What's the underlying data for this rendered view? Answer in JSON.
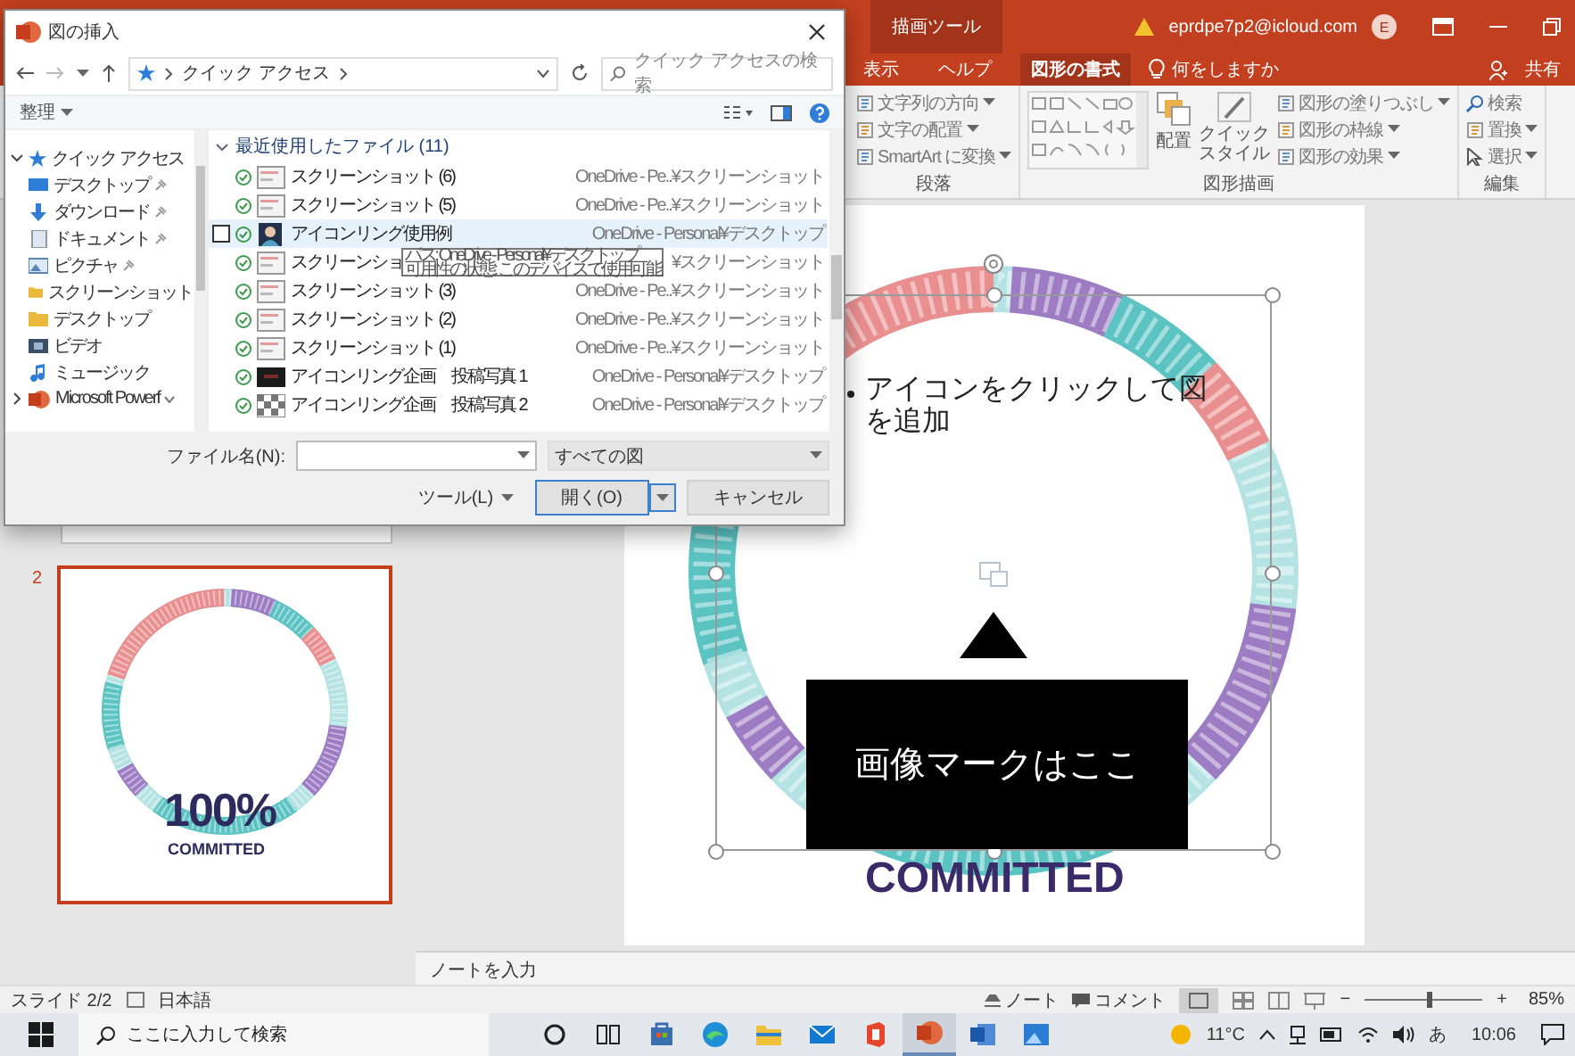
{
  "title_bar": {
    "context_label": "描画ツール",
    "account": "eprdpe7p2@icloud.com",
    "avatar": "E"
  },
  "ribbon_tabs": [
    {
      "label": "表示",
      "selected": false
    },
    {
      "label": "ヘルプ",
      "selected": false
    },
    {
      "label": "図形の書式",
      "selected": true
    }
  ],
  "tell_me": "何をしますか",
  "share": "共有",
  "ribbon_groups": [
    {
      "kind": "paragraph",
      "label": "段落",
      "commands": [
        {
          "label": "文字列の方向",
          "dropdown": true
        },
        {
          "label": "文字の配置",
          "dropdown": true
        },
        {
          "label": "SmartArt に変換",
          "dropdown": true
        }
      ]
    },
    {
      "kind": "drawing",
      "label": "図形描画",
      "arrange": "配置",
      "quick_style": "クイックスタイル",
      "commands": [
        {
          "label": "図形の塗りつぶし",
          "dropdown": true
        },
        {
          "label": "図形の枠線",
          "dropdown": true
        },
        {
          "label": "図形の効果",
          "dropdown": true
        }
      ]
    },
    {
      "kind": "editing",
      "label": "編集",
      "commands": [
        {
          "label": "検索",
          "dropdown": false
        },
        {
          "label": "置換",
          "dropdown": true
        },
        {
          "label": "選択",
          "dropdown": true
        }
      ]
    }
  ],
  "thumbnails": [
    {
      "kind": "blank",
      "selected": false
    },
    {
      "kind": "logo",
      "number": "2",
      "selected": true,
      "logo": "100%",
      "tagline": "COMMITTED"
    }
  ],
  "slide": {
    "bullet": "アイコンをクリックして図を追加",
    "callout": "画像マークはここ",
    "tagline": "COMMITTED"
  },
  "notes_placeholder": "ノートを入力",
  "status_bar": {
    "slide": "スライド 2/2",
    "language": "日本語",
    "notes": "ノート",
    "comments": "コメント",
    "zoom_out": "−",
    "level": 0.55,
    "zoom_in": "+",
    "zoom": "85%"
  },
  "taskbar": {
    "search_placeholder": "ここに入力して検索",
    "apps": [
      {
        "kind": "cortana",
        "selected": false
      },
      {
        "kind": "task-view",
        "selected": false
      },
      {
        "kind": "store",
        "selected": false
      },
      {
        "kind": "edge",
        "selected": false
      },
      {
        "kind": "explorer",
        "selected": false
      },
      {
        "kind": "mail",
        "selected": false
      },
      {
        "kind": "office",
        "selected": false
      },
      {
        "kind": "powerpoint",
        "selected": true
      },
      {
        "kind": "word",
        "selected": false
      },
      {
        "kind": "photos",
        "selected": false
      }
    ],
    "weather": "11°C",
    "ime": "あ",
    "time": "10:06"
  },
  "dialog": {
    "title": "図の挿入",
    "address": "クイック アクセス",
    "search_placeholder": "クイック アクセスの検索",
    "organize": "整理",
    "nav": [
      {
        "label": "クイック アクセス",
        "expanded": true,
        "children": [
          {
            "label": "デスクトップ",
            "kind": "desktop",
            "pinned": true
          },
          {
            "label": "ダウンロード",
            "kind": "download",
            "pinned": true
          },
          {
            "label": "ドキュメント",
            "kind": "document",
            "pinned": true
          },
          {
            "label": "ピクチャ",
            "kind": "picture",
            "pinned": true
          },
          {
            "label": "スクリーンショット",
            "kind": "folder",
            "pinned": false
          },
          {
            "label": "デスクトップ",
            "kind": "folder",
            "pinned": false
          },
          {
            "label": "ビデオ",
            "kind": "video",
            "pinned": false
          },
          {
            "label": "ミュージック",
            "kind": "music",
            "pinned": false
          }
        ]
      },
      {
        "label": "Microsoft Powerf",
        "expanded": false
      }
    ],
    "group": {
      "label": "最近使用したファイル (11)",
      "expanded": true
    },
    "files": [
      {
        "name": "スクリーンショット (6)",
        "location": "OneDrive - Pe..¥スクリーンショット",
        "kind": "screenshot",
        "selected": false
      },
      {
        "name": "スクリーンショット (5)",
        "location": "OneDrive - Pe..¥スクリーンショット",
        "kind": "screenshot",
        "selected": false
      },
      {
        "name": "アイコンリング使用例",
        "location": "OneDrive - Personal¥デスクトップ",
        "kind": "person",
        "selected": true
      },
      {
        "name": "スクリーンショ",
        "location": "¥スクリーンショット",
        "kind": "screenshot",
        "selected": false
      },
      {
        "name": "スクリーンショット (3)",
        "location": "OneDrive - Pe..¥スクリーンショット",
        "kind": "screenshot",
        "selected": false
      },
      {
        "name": "スクリーンショット (2)",
        "location": "OneDrive - Pe..¥スクリーンショット",
        "kind": "screenshot",
        "selected": false
      },
      {
        "name": "スクリーンショット (1)",
        "location": "OneDrive - Pe..¥スクリーンショット",
        "kind": "screenshot",
        "selected": false
      },
      {
        "name": "アイコンリング企画　投稿写真 1",
        "location": "OneDrive - Personal¥デスクトップ",
        "kind": "dark",
        "selected": false
      },
      {
        "name": "アイコンリング企画　投稿写真 2",
        "location": "OneDrive - Personal¥デスクトップ",
        "kind": "checker",
        "selected": false
      }
    ],
    "tooltip": [
      "パス: OneDrive - Personal¥デスクトップ",
      "可用性の状態: このデバイスで使用可能"
    ],
    "filename_label": "ファイル名(N):",
    "filter": "すべての図",
    "tools": "ツール(L)",
    "open": "開く(O)",
    "cancel": "キャンセル"
  }
}
